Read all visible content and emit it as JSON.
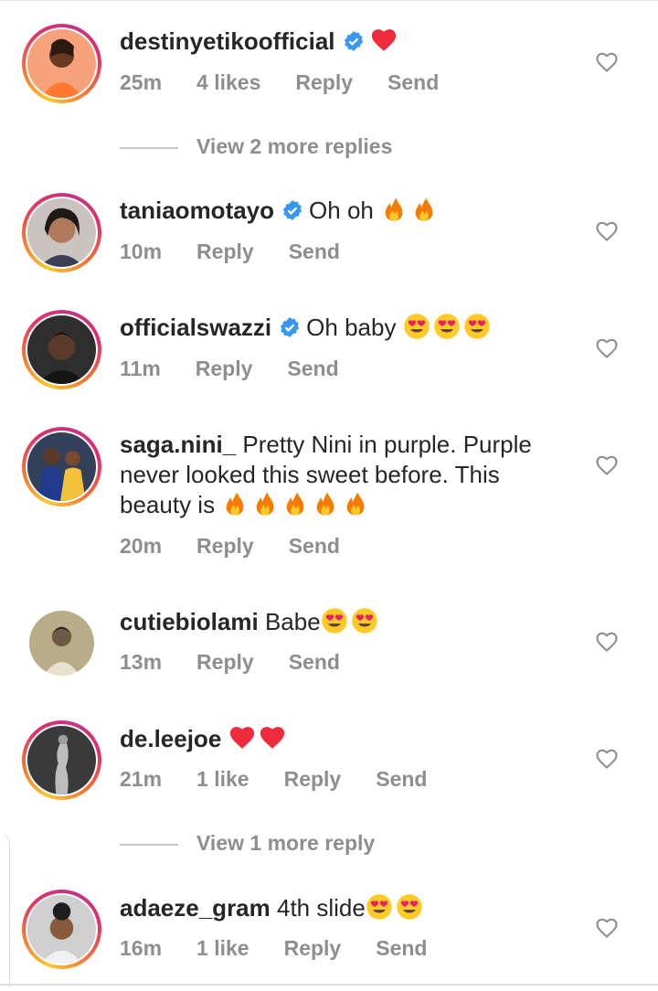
{
  "comments": [
    {
      "username": "destinyetikoofficial",
      "verified": true,
      "text": "",
      "emojis": [
        "red-heart"
      ],
      "time": "25m",
      "likes": "4 likes",
      "reply": "Reply",
      "send": "Send",
      "story_ring": true
    },
    {
      "username": "taniaomotayo",
      "verified": true,
      "text": "Oh oh",
      "emojis": [
        "fire",
        "fire"
      ],
      "time": "10m",
      "likes": "",
      "reply": "Reply",
      "send": "Send",
      "story_ring": true
    },
    {
      "username": "officialswazzi",
      "verified": true,
      "text": "Oh baby",
      "emojis": [
        "heart-eyes",
        "heart-eyes",
        "heart-eyes"
      ],
      "time": "11m",
      "likes": "",
      "reply": "Reply",
      "send": "Send",
      "story_ring": true
    },
    {
      "username": "saga.nini_",
      "verified": false,
      "text": "Pretty Nini in purple. Purple never looked this sweet before. This beauty is",
      "emojis": [
        "fire",
        "fire",
        "fire",
        "fire",
        "fire"
      ],
      "time": "20m",
      "likes": "",
      "reply": "Reply",
      "send": "Send",
      "story_ring": true
    },
    {
      "username": "cutiebiolami",
      "verified": false,
      "text": "Babe",
      "emojis": [
        "heart-eyes",
        "heart-eyes"
      ],
      "time": "13m",
      "likes": "",
      "reply": "Reply",
      "send": "Send",
      "story_ring": false
    },
    {
      "username": "de.leejoe",
      "verified": false,
      "text": "",
      "emojis": [
        "red-heart",
        "red-heart"
      ],
      "time": "21m",
      "likes": "1 like",
      "reply": "Reply",
      "send": "Send",
      "story_ring": true
    },
    {
      "username": "adaeze_gram",
      "verified": false,
      "text": "4th slide",
      "emojis": [
        "heart-eyes",
        "heart-eyes"
      ],
      "time": "16m",
      "likes": "1 like",
      "reply": "Reply",
      "send": "Send",
      "story_ring": true
    }
  ],
  "view_more": [
    "View 2 more replies",
    "View 1 more reply"
  ],
  "colors": {
    "username": "#262626",
    "meta": "#8e8e8e",
    "verified": "#3897f0",
    "heart": "#ed2b3c"
  }
}
